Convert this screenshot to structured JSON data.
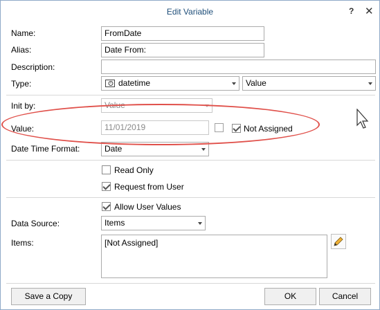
{
  "window": {
    "title": "Edit Variable",
    "help_glyph": "?",
    "close_glyph": "✕"
  },
  "fields": {
    "name_label": "Name:",
    "name_value": "FromDate",
    "alias_label": "Alias:",
    "alias_value": "Date From:",
    "description_label": "Description:",
    "description_value": "",
    "type_label": "Type:",
    "type_value": "datetime",
    "type_kind_value": "Value",
    "initby_label": "Init by:",
    "initby_value": "Value",
    "value_label": "Value:",
    "value_value": "11/01/2019",
    "not_assigned_label": "Not Assigned",
    "datetime_format_label": "Date Time Format:",
    "datetime_format_value": "Date",
    "read_only_label": "Read Only",
    "request_from_user_label": "Request from User",
    "allow_user_values_label": "Allow User Values",
    "data_source_label": "Data Source:",
    "data_source_value": "Items",
    "items_label": "Items:",
    "items_value": "[Not Assigned]"
  },
  "checks": {
    "value_checkbox": false,
    "not_assigned": true,
    "read_only": false,
    "request_from_user": true,
    "allow_user_values": true
  },
  "buttons": {
    "save_copy": "Save a Copy",
    "ok": "OK",
    "cancel": "Cancel"
  },
  "icons": {
    "type_icon": "datetime-icon",
    "edit_icon": "pencil-icon",
    "cursor": "mouse-pointer-icon"
  },
  "colors": {
    "title": "#1e4e79",
    "annotation": "#e0504a"
  }
}
